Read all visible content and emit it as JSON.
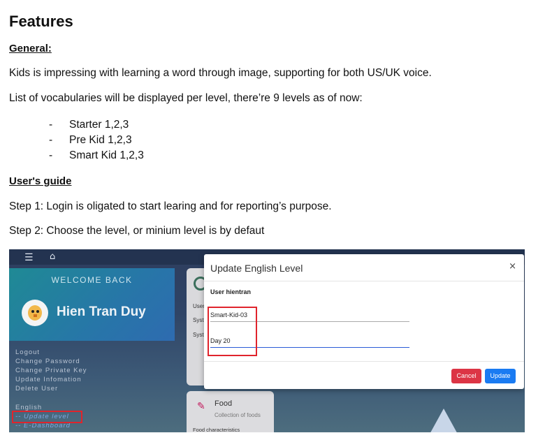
{
  "document": {
    "title": "Features",
    "general_heading": "General:",
    "para1": "Kids is impressing with learning a word through image, supporting for both US/UK voice.",
    "para2": "List of vocabularies will be displayed per level, there’re 9 levels as of now:",
    "levels": [
      {
        "dash": "-",
        "text": "Starter 1,2,3"
      },
      {
        "dash": "-",
        "text": "Pre Kid 1,2,3"
      },
      {
        "dash": "-",
        "text": "Smart Kid 1,2,3"
      }
    ],
    "guide_heading": "User's guide",
    "step1": "Step 1: Login is oligated to start learing and for reporting’s purpose.",
    "step2": "Step 2: Choose the level, or minium level is by defaut"
  },
  "screenshot": {
    "topbar": {
      "menu_icon": "☰",
      "home_icon": "⌂"
    },
    "welcome": {
      "label": "WELCOME BACK",
      "user_name": "Hien Tran Duy"
    },
    "sidebar": {
      "items": [
        "Logout",
        "Change Password",
        "Change Private Key",
        "Update Infomation",
        "Delete User"
      ],
      "section": "English",
      "update_level": "-- Update level",
      "dashboard": "-- E-Dashboard"
    },
    "panel": {
      "lines": [
        "User",
        "Syst",
        "Syst"
      ]
    },
    "food_card": {
      "title": "Food",
      "subtitle": "Collection of foods",
      "characteristics": "Food characteristics"
    },
    "modal": {
      "title": "Update English Level",
      "close": "×",
      "user_label": "User hientran",
      "level_value": "Smart-Kid-03",
      "day_value": "Day 20",
      "cancel": "Cancel",
      "update": "Update"
    },
    "colors": {
      "highlight_box": "#e0242c",
      "cancel": "#dc3545",
      "update": "#1a7bf2"
    }
  }
}
